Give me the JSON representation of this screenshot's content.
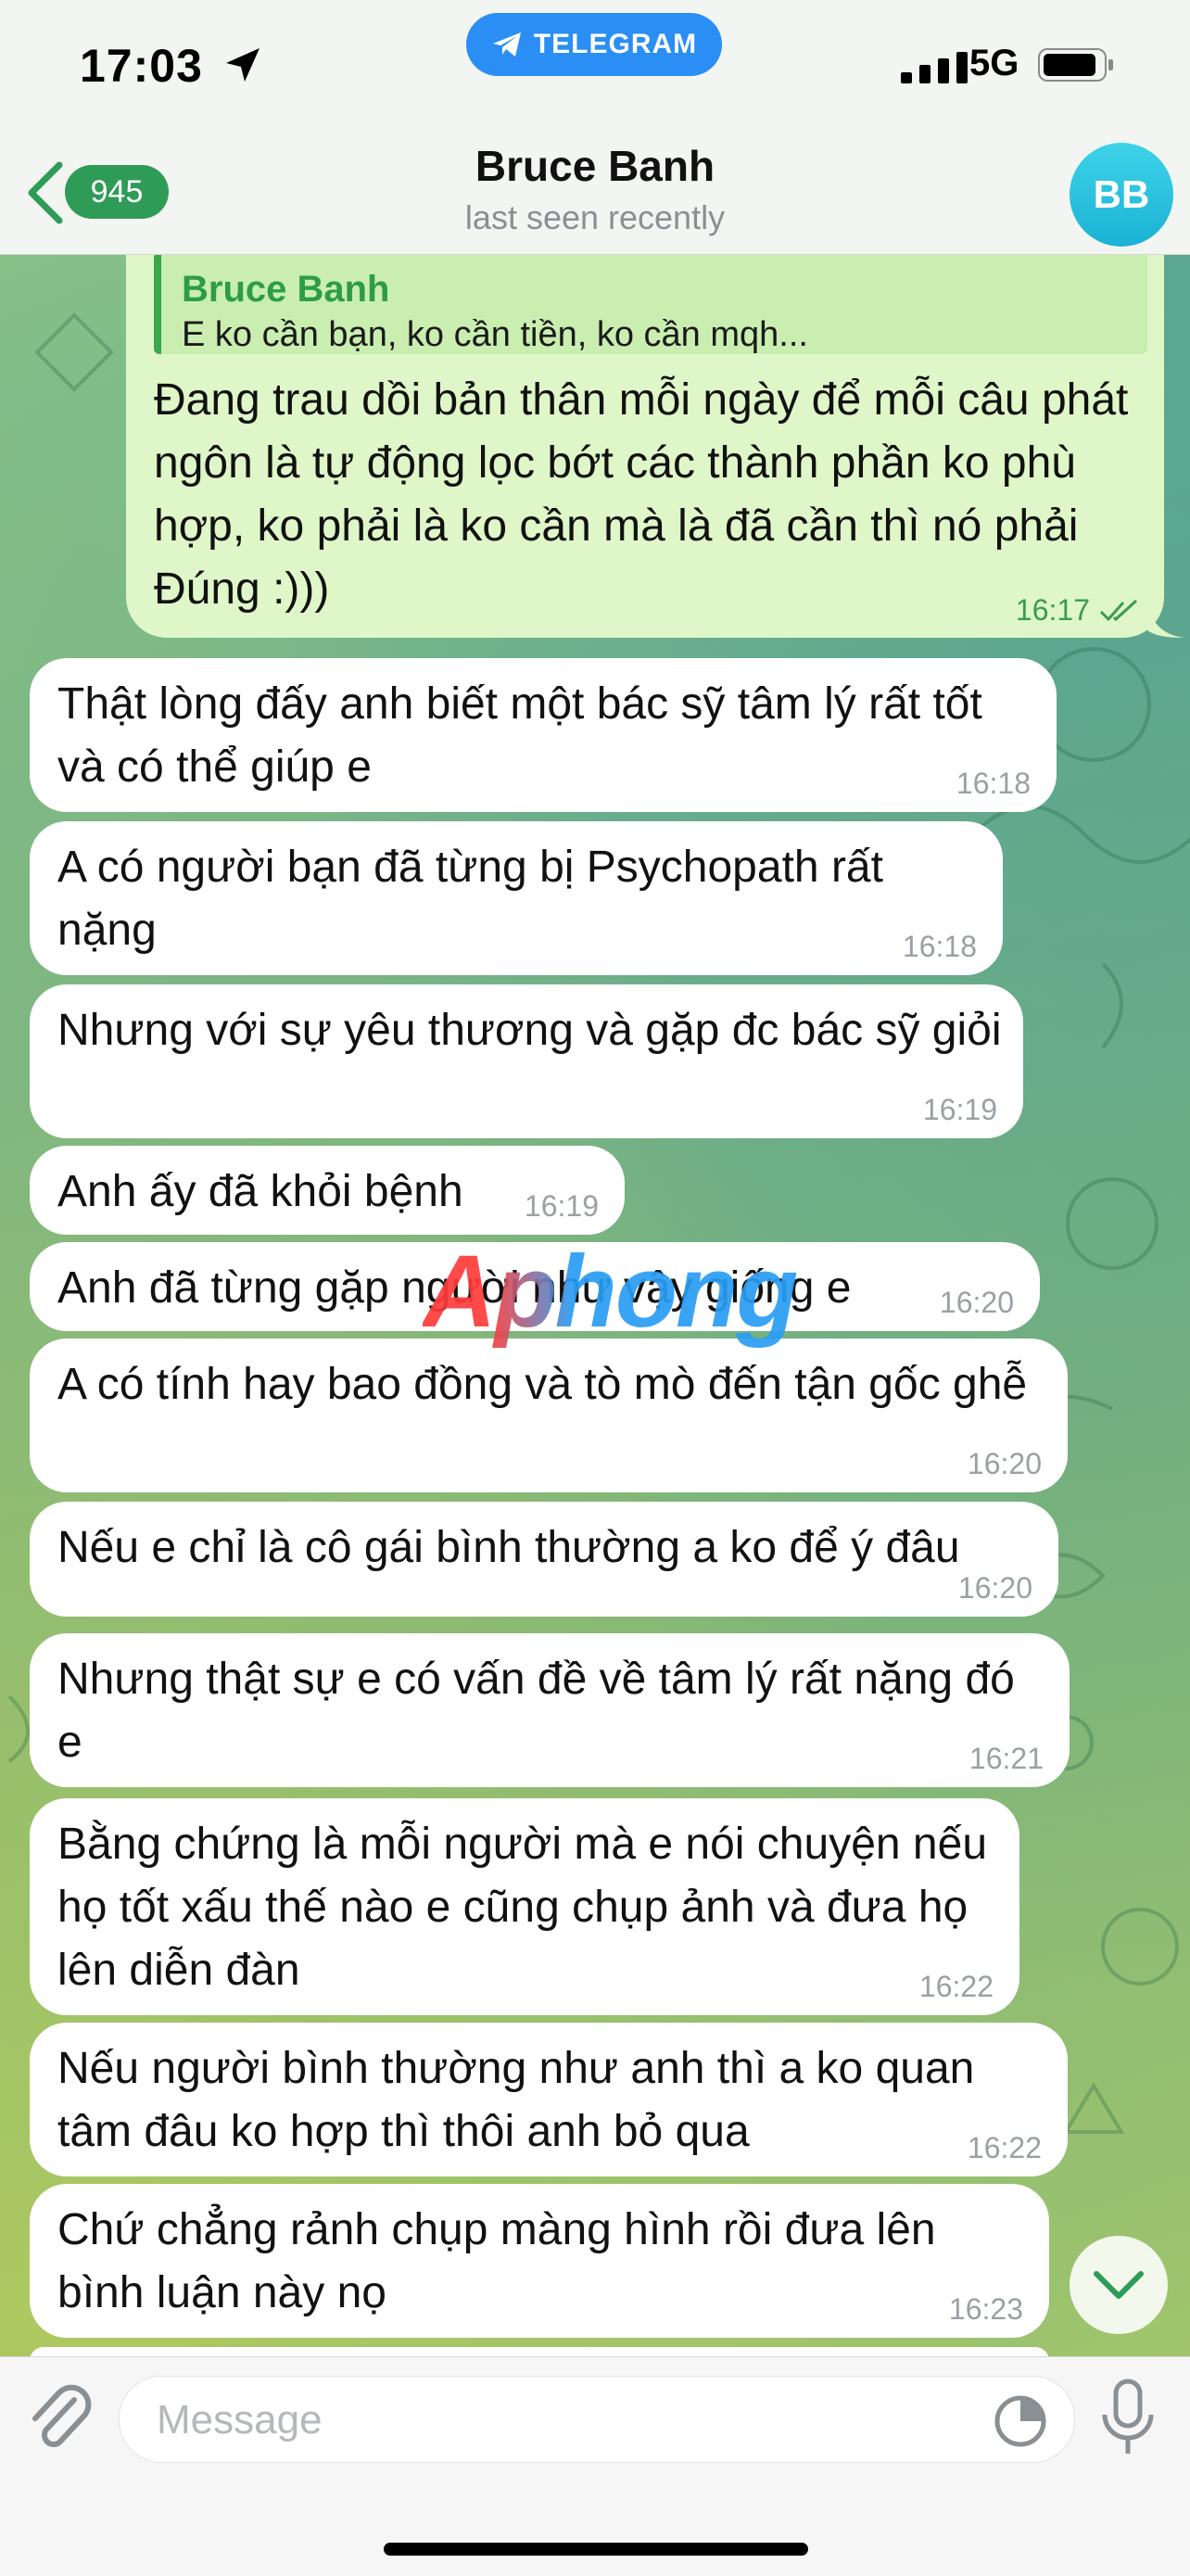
{
  "status_bar": {
    "time": "17:03",
    "banner": "TELEGRAM",
    "network": "5G"
  },
  "header": {
    "back_badge": "945",
    "name": "Bruce Banh",
    "last_seen": "last seen recently",
    "avatar_initials": "BB"
  },
  "outgoing": {
    "reply_name": "Bruce Banh",
    "reply_text": "E ko cần bạn, ko cần tiền, ko cần mqh...",
    "text": "Đang trau dồi bản thân mỗi ngày để mỗi câu phát ngôn là tự động lọc bớt các thành phần ko phù hợp, ko phải là ko cần mà là đã cần thì nó phải Đúng :)))",
    "time": "16:17"
  },
  "messages": [
    {
      "text": "Thật lòng đấy anh biết một bác sỹ tâm lý rất tốt và có thể giúp e",
      "time": "16:18"
    },
    {
      "text": "A có người bạn đã từng bị Psychopath rất nặng",
      "time": "16:18"
    },
    {
      "text": "Nhưng với sự yêu thương và gặp đc bác sỹ giỏi",
      "time": "16:19"
    },
    {
      "text": "Anh ấy đã khỏi bệnh",
      "time": "16:19"
    },
    {
      "text": "Anh đã từng gặp người như vậy giống e",
      "time": "16:20"
    },
    {
      "text": "A có tính hay bao đồng và tò mò đến tận gốc ghễ",
      "time": "16:20"
    },
    {
      "text": "Nếu e chỉ là cô gái bình thường a ko để ý đâu",
      "time": "16:20"
    },
    {
      "text": "Nhưng thật sự e có vấn đề về tâm lý rất nặng đó e",
      "time": "16:21"
    },
    {
      "text": "Bằng chứng là mỗi người mà e nói chuyện nếu họ tốt xấu thế nào e cũng chụp ảnh và đưa họ lên diễn đàn",
      "time": "16:22"
    },
    {
      "text": "Nếu người bình thường như anh thì a ko quan tâm đâu ko hợp thì thôi anh bỏ qua",
      "time": "16:22"
    },
    {
      "text": "Chứ chẳng rảnh chụp màng hình rồi đưa lên bình luận này nọ",
      "time": "16:23"
    }
  ],
  "watermark": "Aphong",
  "input": {
    "placeholder": "Message",
    "value": ""
  },
  "colors": {
    "outgoing_bubble": "#dff7c8",
    "incoming_bubble": "#ffffff",
    "accent_green": "#2e9c56",
    "telegram_blue": "#2a8ef5"
  },
  "icons": [
    "location-arrow-icon",
    "telegram-plane-icon",
    "signal-bars-icon",
    "battery-icon",
    "chevron-left-icon",
    "double-check-icon",
    "chevron-down-icon",
    "paperclip-icon",
    "sticker-icon",
    "microphone-icon"
  ]
}
